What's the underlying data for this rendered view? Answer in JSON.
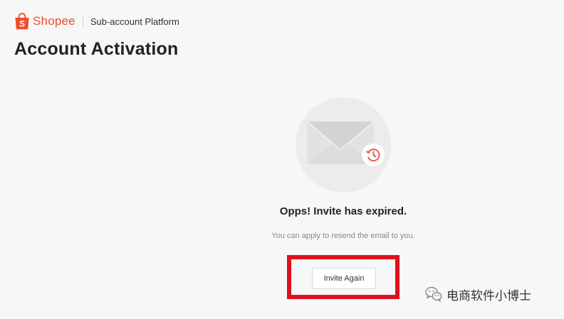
{
  "header": {
    "brand": "Shopee",
    "platform_name": "Sub-account Platform"
  },
  "page": {
    "title": "Account Activation"
  },
  "message": {
    "title": "Opps! Invite has expired.",
    "subtitle": "You can apply to resend the email to you."
  },
  "actions": {
    "invite_again_label": "Invite Again"
  },
  "watermark": {
    "text": "电商软件小博士"
  },
  "icons": {
    "logo": "shopee-bag-icon",
    "illustration": "envelope-icon",
    "badge": "clock-history-icon",
    "watermark": "wechat-icon"
  },
  "colors": {
    "brand": "#ee4d2d",
    "background": "#f7f7f7",
    "highlight_border": "#e0101e",
    "badge_icon": "#ee5a4a"
  }
}
